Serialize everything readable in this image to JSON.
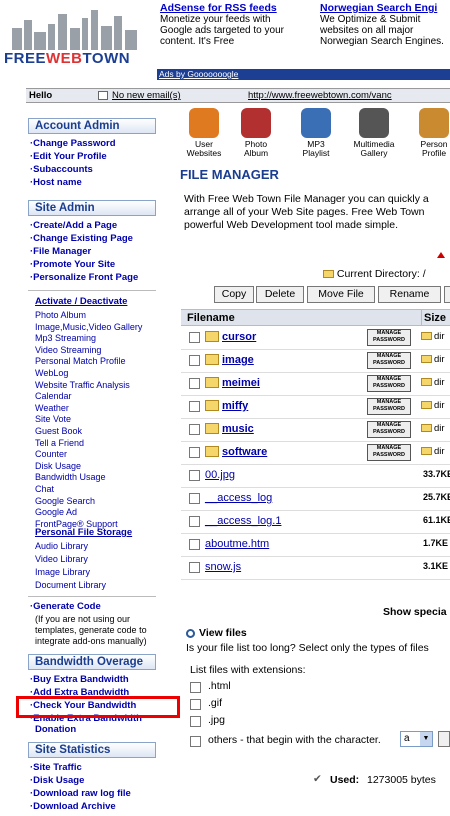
{
  "header": {
    "logo_text": "FREEWEBTOWN",
    "ads": [
      {
        "title": "AdSense for RSS feeds",
        "lines": [
          "Monetize your feeds with",
          "Google ads targeted to your",
          "content. It's Free"
        ]
      },
      {
        "title": "Norwegian Search Engi",
        "lines": [
          "We Optimize & Submit",
          "websites on all major",
          "Norwegian Search Engines."
        ]
      }
    ],
    "ads_by": "Ads by Gooooooogle",
    "hello": "Hello",
    "email": "No new email(s)",
    "url": "http://www.freewebtown.com/vanc"
  },
  "toolbar": [
    {
      "label": "User Websites",
      "icon": "user-websites-icon",
      "color": "#e07a20"
    },
    {
      "label": "Photo Album",
      "icon": "photo-album-icon",
      "color": "#b23030"
    },
    {
      "label": "MP3 Playlist",
      "icon": "mp3-playlist-icon",
      "color": "#3a6fb5"
    },
    {
      "label": "Multimedia Gallery",
      "icon": "multimedia-gallery-icon",
      "color": "#555"
    },
    {
      "label": "Person Profile",
      "icon": "person-profile-icon",
      "color": "#c98a30"
    }
  ],
  "sidebar": {
    "account_admin": {
      "title": "Account Admin",
      "items": [
        "Change Password",
        "Edit Your Profile",
        "Subaccounts",
        "Host name"
      ]
    },
    "site_admin": {
      "title": "Site Admin",
      "items": [
        "Create/Add a Page",
        "Change Existing Page",
        "File Manager",
        "Promote Your Site",
        "Personalize Front Page"
      ]
    },
    "activate": {
      "title": "Activate / Deactivate",
      "items": [
        "Photo Album",
        "Image,Music,Video Gallery",
        "Mp3 Streaming",
        "Video Streaming",
        "Personal Match Profile",
        "WebLog",
        "Website Traffic Analysis",
        "Calendar",
        "Weather",
        "Site Vote",
        "Guest Book",
        "Tell a Friend",
        "Counter",
        "Disk Usage",
        "Bandwidth Usage",
        "Chat",
        "Google Search",
        "Google Ad",
        "FrontPage® Support"
      ]
    },
    "storage": {
      "title": "Personal File Storage",
      "items": [
        "Audio Library",
        "Video Library",
        "Image Library",
        "Document Library"
      ]
    },
    "generate": {
      "title": "Generate Code",
      "note": [
        "(If you are not using our",
        "templates, generate code to",
        "integrate add-ons manually)"
      ]
    },
    "bandwidth": {
      "title": "Bandwidth Overage",
      "items": [
        "Buy Extra Bandwidth",
        "Add Extra Bandwidth",
        "Check Your Bandwidth",
        "Enable Extra Bandwidth",
        "Donation"
      ]
    },
    "stats": {
      "title": "Site Statistics",
      "items": [
        "Site Traffic",
        "Disk Usage",
        "Download raw log file",
        "Download Archive"
      ]
    }
  },
  "main": {
    "title": "FILE MANAGER",
    "intro": [
      "With Free Web Town File Manager you can quickly a",
      "arrange all of your Web Site pages. Free Web Town",
      "powerful Web Development tool made simple."
    ],
    "current_dir": "Current Directory: /",
    "buttons": [
      "Copy",
      "Delete",
      "Move File",
      "Rename",
      ""
    ],
    "columns": [
      "Filename",
      "Size"
    ],
    "manage_label": "MANAGE PASSWORD",
    "dir_label": "dir",
    "rows": [
      {
        "name": "cursor",
        "type": "dir"
      },
      {
        "name": "image",
        "type": "dir"
      },
      {
        "name": "meimei",
        "type": "dir"
      },
      {
        "name": "miffy",
        "type": "dir"
      },
      {
        "name": "music",
        "type": "dir"
      },
      {
        "name": "software",
        "type": "dir"
      },
      {
        "name": "00.jpg",
        "type": "file",
        "size": "33.7KE"
      },
      {
        "name": "__access_log",
        "type": "file",
        "size": "25.7KE"
      },
      {
        "name": "__access_log.1",
        "type": "file",
        "size": "61.1KE"
      },
      {
        "name": "aboutme.htm",
        "type": "file",
        "size": "1.7KE"
      },
      {
        "name": "snow.js",
        "type": "file",
        "size": "3.1KE"
      }
    ],
    "show_special": "Show specia",
    "view_files": "View files",
    "view_question": "Is your file list too long? Select only the types of files",
    "list_ext": "List files with extensions:",
    "extensions": [
      ".html",
      ".gif",
      ".jpg",
      "others - that begin with the character."
    ],
    "char_value": "a",
    "used_label": "Used:",
    "used_value": "1273005 bytes"
  }
}
